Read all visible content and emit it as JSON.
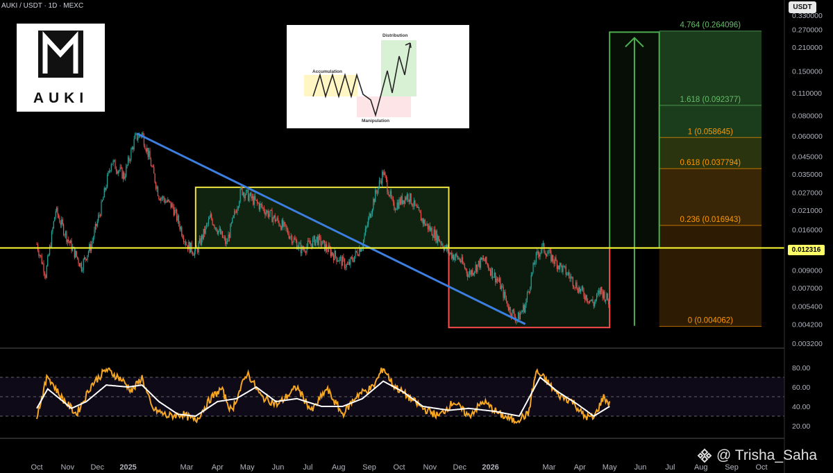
{
  "header": {
    "symbol_line": "AUKI / USDT · 1D · MEXC",
    "currency_badge": "USDT"
  },
  "logo": {
    "text": "AUKI"
  },
  "inset": {
    "accumulation_label": "Accumulation",
    "manipulation_label": "Manipulation",
    "distribution_label": "Distribution"
  },
  "current_price_label": "0.012316",
  "watermark": {
    "text": "@ Trisha_Saha"
  },
  "colors": {
    "bull": "#26a69a",
    "bear": "#ef5350",
    "trendline": "#3d7fe0",
    "range_box": "#f0e442",
    "accumulation_zone": "#ff4d4d",
    "target_arrow": "#4caf50",
    "price_line": "#ffff33",
    "rsi": "#f5a623",
    "rsi_ma": "#ffffff"
  },
  "chart_data": {
    "type": "candlestick",
    "scale": "log",
    "x_ticks": [
      "Oct",
      "Nov",
      "Dec",
      "2025",
      "Mar",
      "Apr",
      "May",
      "Jun",
      "Jul",
      "Aug",
      "Sep",
      "Oct",
      "Nov",
      "Dec",
      "2026",
      "Mar",
      "Apr",
      "May",
      "Jun",
      "Jul",
      "Aug",
      "Sep",
      "Oct"
    ],
    "y_ticks": [
      "0.330000",
      "0.270000",
      "0.210000",
      "0.150000",
      "0.110000",
      "0.080000",
      "0.060000",
      "0.045000",
      "0.035000",
      "0.027000",
      "0.021000",
      "0.016000",
      "0.012316",
      "0.009000",
      "0.007000",
      "0.005400",
      "0.004200",
      "0.003200"
    ],
    "current_price": 0.012316,
    "price_path": [
      [
        "2024-10-01",
        0.013
      ],
      [
        "2024-10-10",
        0.0085
      ],
      [
        "2024-10-20",
        0.021
      ],
      [
        "2024-11-01",
        0.014
      ],
      [
        "2024-11-15",
        0.0095
      ],
      [
        "2024-11-25",
        0.013
      ],
      [
        "2024-12-05",
        0.022
      ],
      [
        "2024-12-15",
        0.042
      ],
      [
        "2024-12-28",
        0.034
      ],
      [
        "2025-01-08",
        0.058
      ],
      [
        "2025-01-15",
        0.062
      ],
      [
        "2025-01-22",
        0.045
      ],
      [
        "2025-02-01",
        0.026
      ],
      [
        "2025-02-15",
        0.022
      ],
      [
        "2025-03-01",
        0.013
      ],
      [
        "2025-03-10",
        0.0115
      ],
      [
        "2025-03-25",
        0.019
      ],
      [
        "2025-04-10",
        0.013
      ],
      [
        "2025-04-25",
        0.028
      ],
      [
        "2025-05-15",
        0.022
      ],
      [
        "2025-06-05",
        0.017
      ],
      [
        "2025-06-25",
        0.012
      ],
      [
        "2025-07-10",
        0.014
      ],
      [
        "2025-07-25",
        0.0115
      ],
      [
        "2025-08-10",
        0.0095
      ],
      [
        "2025-08-25",
        0.013
      ],
      [
        "2025-09-05",
        0.024
      ],
      [
        "2025-09-15",
        0.036
      ],
      [
        "2025-09-25",
        0.022
      ],
      [
        "2025-10-10",
        0.026
      ],
      [
        "2025-10-25",
        0.018
      ],
      [
        "2025-11-10",
        0.014
      ],
      [
        "2025-11-20",
        0.0115
      ],
      [
        "2025-12-01",
        0.0105
      ],
      [
        "2025-12-10",
        0.0085
      ],
      [
        "2025-12-25",
        0.0105
      ],
      [
        "2026-01-10",
        0.0075
      ],
      [
        "2026-01-20",
        0.0052
      ],
      [
        "2026-01-28",
        0.0045
      ],
      [
        "2026-02-05",
        0.0055
      ],
      [
        "2026-02-15",
        0.0105
      ],
      [
        "2026-02-22",
        0.0125
      ],
      [
        "2026-03-05",
        0.0105
      ],
      [
        "2026-03-20",
        0.0085
      ],
      [
        "2026-04-01",
        0.0068
      ],
      [
        "2026-04-15",
        0.0056
      ],
      [
        "2026-04-22",
        0.0068
      ],
      [
        "2026-05-01",
        0.0057
      ]
    ],
    "trendline": [
      [
        "2025-01-10",
        0.062
      ],
      [
        "2026-02-05",
        0.0042
      ]
    ],
    "range_box": {
      "from": "2025-03-10",
      "to": "2025-11-20",
      "low": 0.0123,
      "high": 0.029
    },
    "accumulation_box": {
      "from": "2025-11-20",
      "to": "2026-05-01",
      "low": 0.004,
      "high": 0.0123
    },
    "target_box": {
      "from": "2026-05-01",
      "to": "2026-06-20",
      "low": 0.0123,
      "high": 0.26
    },
    "fibonacci": {
      "from": "2026-06-20",
      "to": "2026-10-01",
      "levels": [
        {
          "label": "4.764 (0.264096)",
          "value": 0.264096
        },
        {
          "label": "1.618 (0.092377)",
          "value": 0.092377
        },
        {
          "label": "1 (0.058645)",
          "value": 0.058645
        },
        {
          "label": "0.618 (0.037794)",
          "value": 0.037794
        },
        {
          "label": "0.236 (0.016943)",
          "value": 0.016943
        },
        {
          "label": "0 (0.004062)",
          "value": 0.004062
        }
      ]
    },
    "rsi": {
      "y_ticks": [
        "80.00",
        "60.00",
        "40.00",
        "20.00"
      ],
      "band": [
        30,
        70
      ],
      "path": [
        [
          "2024-10-01",
          30
        ],
        [
          "2024-10-12",
          72
        ],
        [
          "2024-10-25",
          50
        ],
        [
          "2024-11-10",
          32
        ],
        [
          "2024-11-25",
          62
        ],
        [
          "2024-12-10",
          78
        ],
        [
          "2024-12-25",
          68
        ],
        [
          "2025-01-05",
          56
        ],
        [
          "2025-01-15",
          70
        ],
        [
          "2025-01-25",
          38
        ],
        [
          "2025-02-10",
          30
        ],
        [
          "2025-02-25",
          32
        ],
        [
          "2025-03-10",
          25
        ],
        [
          "2025-03-25",
          48
        ],
        [
          "2025-04-05",
          58
        ],
        [
          "2025-04-15",
          35
        ],
        [
          "2025-05-01",
          75
        ],
        [
          "2025-05-15",
          50
        ],
        [
          "2025-06-01",
          42
        ],
        [
          "2025-06-20",
          60
        ],
        [
          "2025-07-05",
          35
        ],
        [
          "2025-07-20",
          58
        ],
        [
          "2025-08-05",
          32
        ],
        [
          "2025-08-20",
          52
        ],
        [
          "2025-09-05",
          60
        ],
        [
          "2025-09-15",
          80
        ],
        [
          "2025-09-25",
          62
        ],
        [
          "2025-10-10",
          50
        ],
        [
          "2025-10-25",
          38
        ],
        [
          "2025-11-10",
          30
        ],
        [
          "2025-11-25",
          45
        ],
        [
          "2025-12-10",
          30
        ],
        [
          "2025-12-25",
          45
        ],
        [
          "2026-01-10",
          32
        ],
        [
          "2026-01-25",
          25
        ],
        [
          "2026-02-08",
          32
        ],
        [
          "2026-02-16",
          76
        ],
        [
          "2026-02-25",
          68
        ],
        [
          "2026-03-10",
          52
        ],
        [
          "2026-03-25",
          45
        ],
        [
          "2026-04-05",
          30
        ],
        [
          "2026-04-15",
          28
        ],
        [
          "2026-04-25",
          50
        ],
        [
          "2026-05-01",
          42
        ]
      ],
      "ma_path": [
        [
          "2024-10-01",
          38
        ],
        [
          "2024-10-12",
          58
        ],
        [
          "2024-11-05",
          38
        ],
        [
          "2024-11-20",
          45
        ],
        [
          "2024-12-10",
          62
        ],
        [
          "2025-01-01",
          60
        ],
        [
          "2025-01-15",
          62
        ],
        [
          "2025-02-01",
          45
        ],
        [
          "2025-02-20",
          32
        ],
        [
          "2025-03-10",
          30
        ],
        [
          "2025-04-01",
          45
        ],
        [
          "2025-04-20",
          48
        ],
        [
          "2025-05-10",
          60
        ],
        [
          "2025-05-30",
          45
        ],
        [
          "2025-06-20",
          48
        ],
        [
          "2025-07-15",
          40
        ],
        [
          "2025-08-05",
          40
        ],
        [
          "2025-08-25",
          48
        ],
        [
          "2025-09-15",
          66
        ],
        [
          "2025-10-05",
          55
        ],
        [
          "2025-10-25",
          40
        ],
        [
          "2025-11-20",
          36
        ],
        [
          "2025-12-10",
          38
        ],
        [
          "2026-01-05",
          35
        ],
        [
          "2026-01-30",
          30
        ],
        [
          "2026-02-20",
          70
        ],
        [
          "2026-03-10",
          55
        ],
        [
          "2026-03-30",
          42
        ],
        [
          "2026-04-15",
          30
        ],
        [
          "2026-05-01",
          40
        ]
      ]
    }
  }
}
